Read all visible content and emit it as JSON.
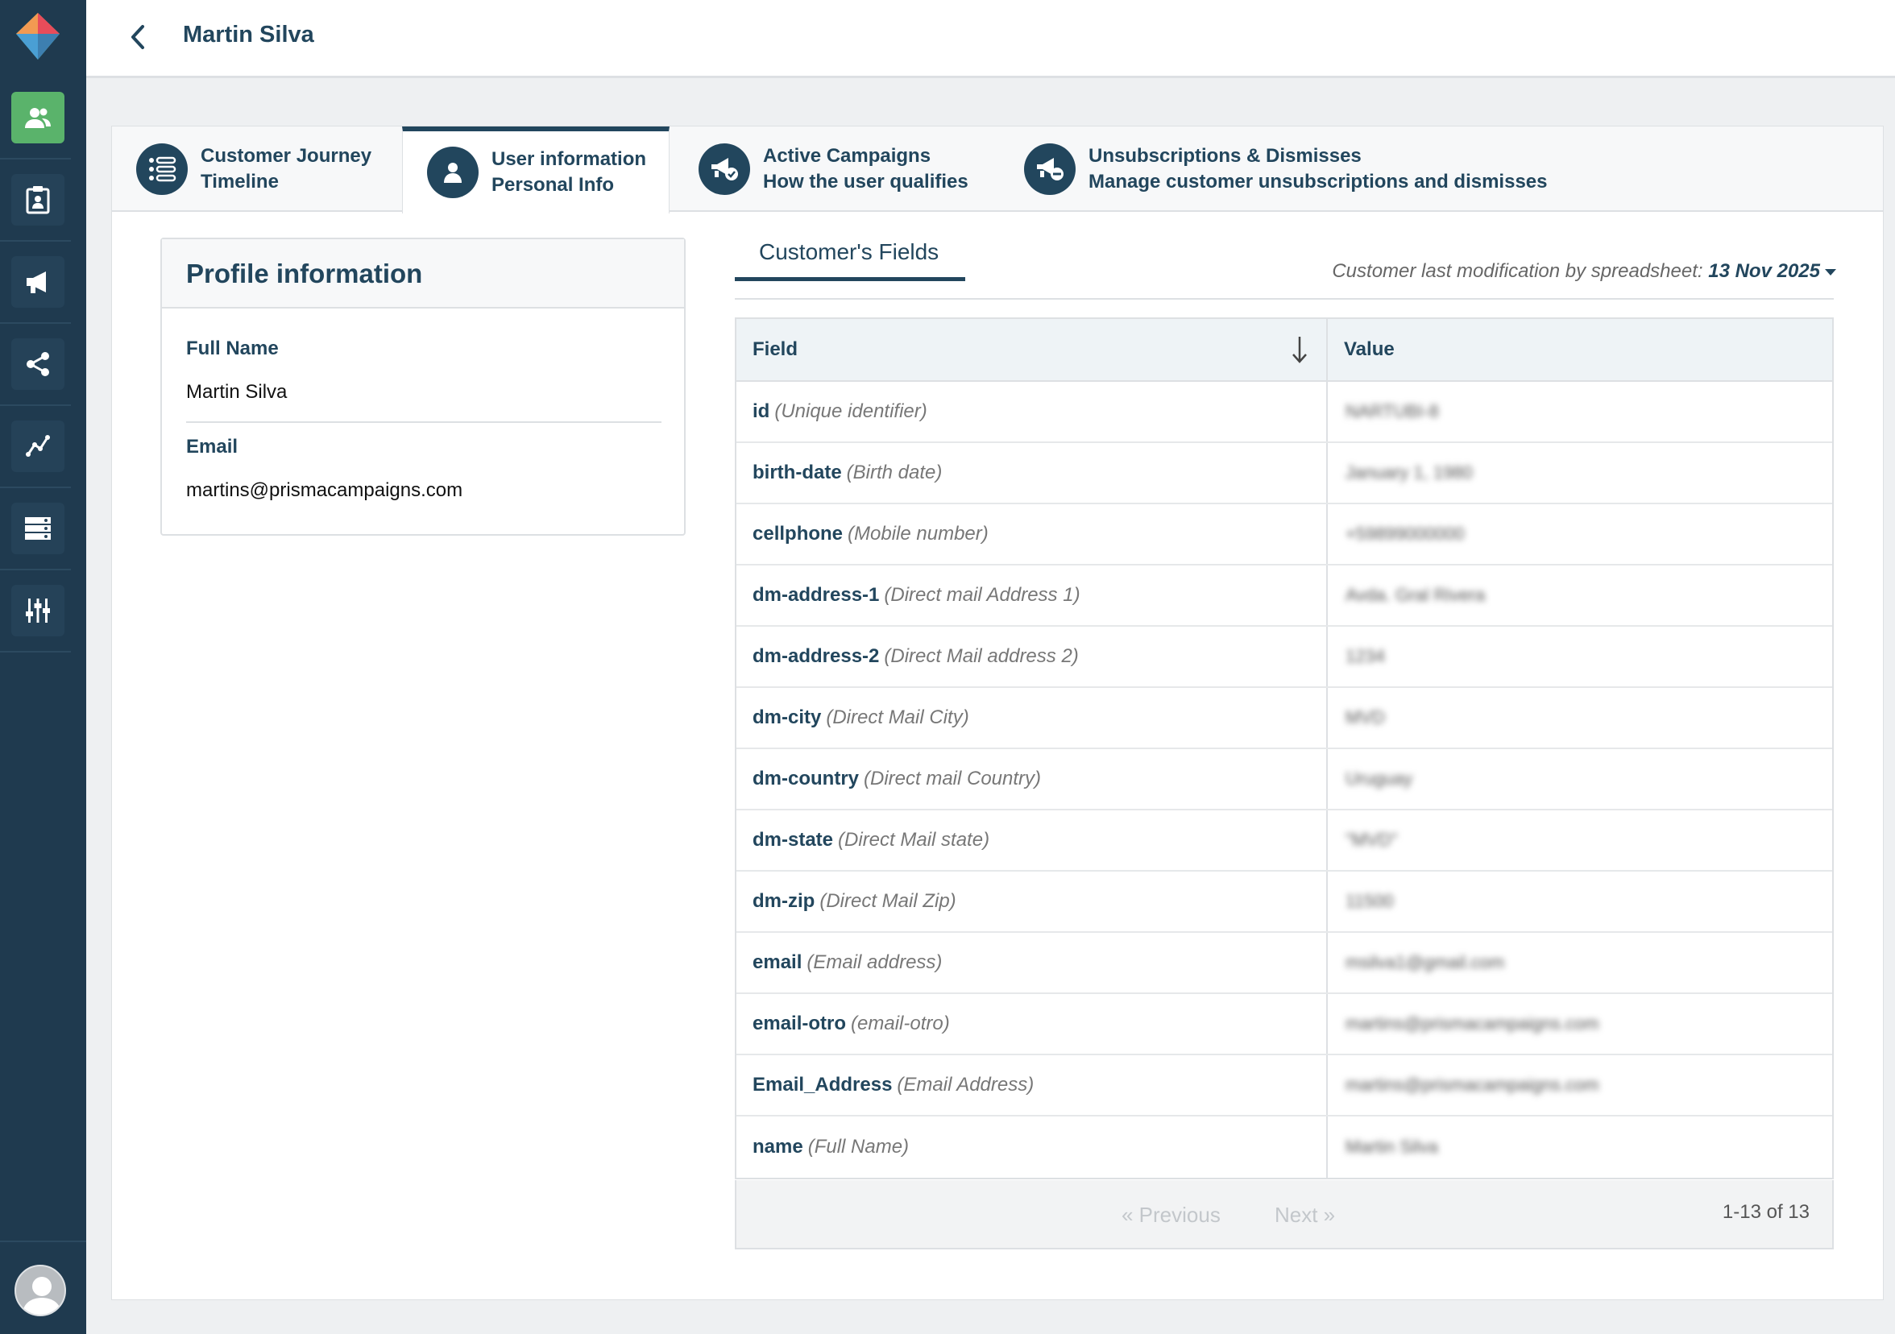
{
  "header": {
    "title": "Martin Silva"
  },
  "sidebar": {
    "items": [
      {
        "icon": "users-icon",
        "active": true
      },
      {
        "icon": "clipboard-user-icon",
        "active": false
      },
      {
        "icon": "megaphone-icon",
        "active": false
      },
      {
        "icon": "share-nodes-icon",
        "active": false
      },
      {
        "icon": "analytics-line-icon",
        "active": false
      },
      {
        "icon": "server-rows-icon",
        "active": false
      },
      {
        "icon": "sliders-icon",
        "active": false
      }
    ]
  },
  "tabs": [
    {
      "title": "Customer Journey",
      "subtitle": "Timeline",
      "icon": "list-timeline-icon",
      "active": false
    },
    {
      "title": "User information",
      "subtitle": "Personal Info",
      "icon": "user-icon",
      "active": true
    },
    {
      "title": "Active Campaigns",
      "subtitle": "How the user qualifies",
      "icon": "megaphone-check-icon",
      "active": false
    },
    {
      "title": "Unsubscriptions & Dismisses",
      "subtitle": "Manage customer unsubscriptions and dismisses",
      "icon": "megaphone-minus-icon",
      "active": false
    }
  ],
  "profile": {
    "heading": "Profile information",
    "full_name_label": "Full Name",
    "full_name": "Martin Silva",
    "email_label": "Email",
    "email": "martins@prismacampaigns.com"
  },
  "fields": {
    "tab_label": "Customer's Fields",
    "last_mod_prefix": "Customer last modification by spreadsheet:",
    "last_mod_date": "13 Nov 2025",
    "col_field": "Field",
    "col_value": "Value",
    "rows": [
      {
        "key": "id",
        "desc": "(Unique identifier)",
        "value": "NARTUBI-8"
      },
      {
        "key": "birth-date",
        "desc": "(Birth date)",
        "value": "January 1, 1980"
      },
      {
        "key": "cellphone",
        "desc": "(Mobile number)",
        "value": "+59899000000"
      },
      {
        "key": "dm-address-1",
        "desc": "(Direct mail Address 1)",
        "value": "Avda. Gral Rivera"
      },
      {
        "key": "dm-address-2",
        "desc": "(Direct Mail address 2)",
        "value": "1234"
      },
      {
        "key": "dm-city",
        "desc": "(Direct Mail City)",
        "value": "MVD"
      },
      {
        "key": "dm-country",
        "desc": "(Direct mail Country)",
        "value": "Uruguay"
      },
      {
        "key": "dm-state",
        "desc": "(Direct Mail state)",
        "value": "\"MVD\""
      },
      {
        "key": "dm-zip",
        "desc": "(Direct Mail Zip)",
        "value": "11500"
      },
      {
        "key": "email",
        "desc": "(Email address)",
        "value": "msilva1@gmail.com"
      },
      {
        "key": "email-otro",
        "desc": "(email-otro)",
        "value": "martins@prismacampaigns.com"
      },
      {
        "key": "Email_Address",
        "desc": "(Email Address)",
        "value": "martins@prismacampaigns.com"
      },
      {
        "key": "name",
        "desc": "(Full Name)",
        "value": "Martin Silva"
      }
    ],
    "pager": {
      "previous": "« Previous",
      "next": "Next »",
      "count": "1-13 of 13"
    }
  },
  "colors": {
    "brand_navy": "#22465d",
    "sidebar_bg": "#1f3a4f",
    "active_green": "#5ab36b"
  }
}
